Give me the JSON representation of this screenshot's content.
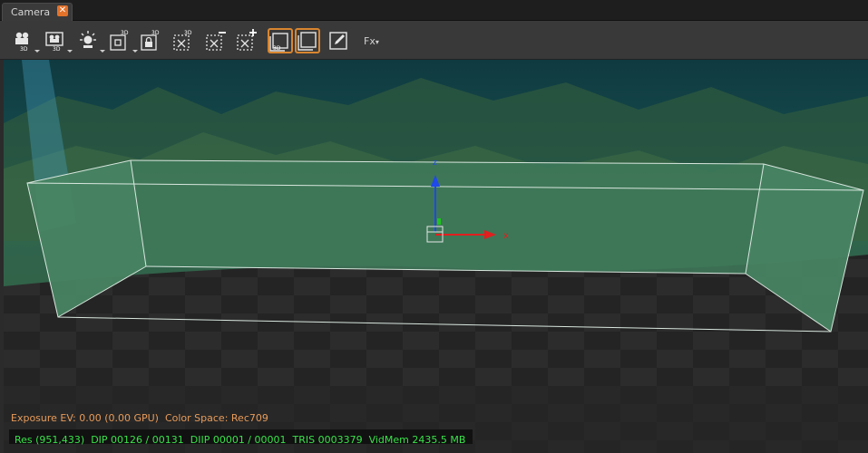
{
  "tab": {
    "label": "Camera",
    "close_icon": "close-icon"
  },
  "toolbar": {
    "buttons": [
      {
        "icon": "camera-3d-icon",
        "badge": "3D"
      },
      {
        "icon": "camera-3d-alt-icon",
        "badge": "3D"
      },
      {
        "icon": "light-icon"
      },
      {
        "icon": "frame-3d-icon",
        "badge": "3D"
      },
      {
        "icon": "lock-3d-icon",
        "badge": "3D"
      },
      {
        "icon": "select-3d-icon",
        "badge": "3D"
      },
      {
        "icon": "select-minus-icon"
      },
      {
        "icon": "select-plus-icon"
      },
      {
        "icon": "view-3d-icon",
        "badge": "3D",
        "active": true
      },
      {
        "icon": "view-2d-icon",
        "active": true
      },
      {
        "icon": "edit-icon"
      }
    ],
    "fx_label": "Fx"
  },
  "viewport": {
    "axis_x_label": "x",
    "axis_z_label": "z",
    "colors": {
      "box_fill": "#3f7a5b",
      "axis_x": "#e21e1e",
      "axis_z": "#1f49e8",
      "axis_y": "#21c321"
    }
  },
  "status": {
    "exposure_text": "Exposure EV: 0.00 (0.00 GPU)  Color Space: Rec709",
    "stats_text": "Res (951,433)  DIP 00126 / 00131  DIIP 00001 / 00001  TRIS 0003379  VidMem 2435.5 MB"
  }
}
